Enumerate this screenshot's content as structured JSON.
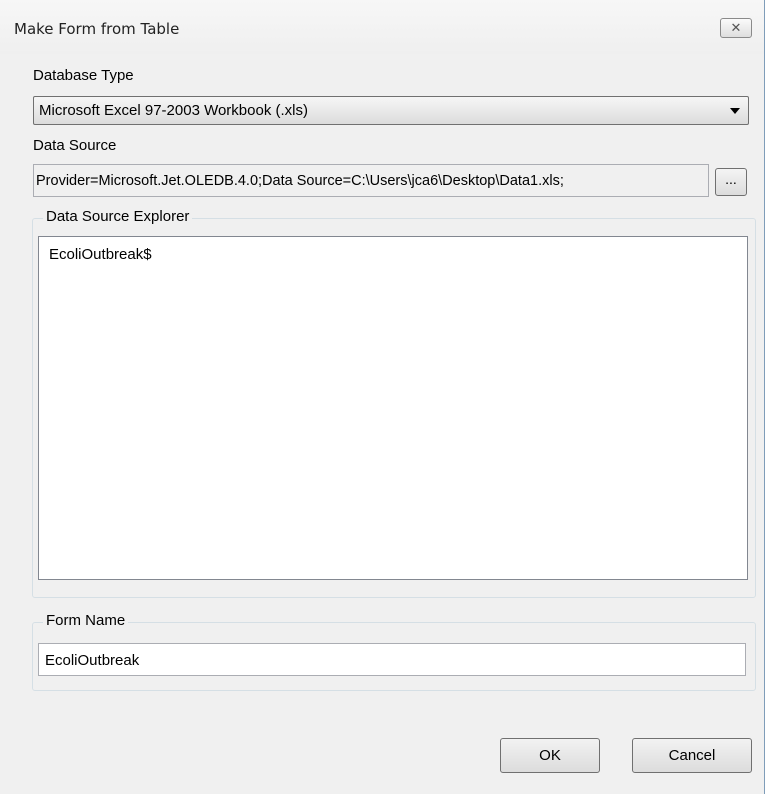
{
  "window": {
    "title": "Make Form from Table",
    "close_glyph": "✕"
  },
  "database_type": {
    "label": "Database Type",
    "selected": "Microsoft Excel 97-2003 Workbook (.xls)"
  },
  "data_source": {
    "label": "Data Source",
    "value": "Provider=Microsoft.Jet.OLEDB.4.0;Data Source=C:\\Users\\jca6\\Desktop\\Data1.xls;",
    "browse_label": "..."
  },
  "explorer": {
    "legend": "Data Source Explorer",
    "items": [
      "EcoliOutbreak$"
    ]
  },
  "form_name": {
    "legend": "Form Name",
    "value": "EcoliOutbreak"
  },
  "buttons": {
    "ok": "OK",
    "cancel": "Cancel"
  }
}
